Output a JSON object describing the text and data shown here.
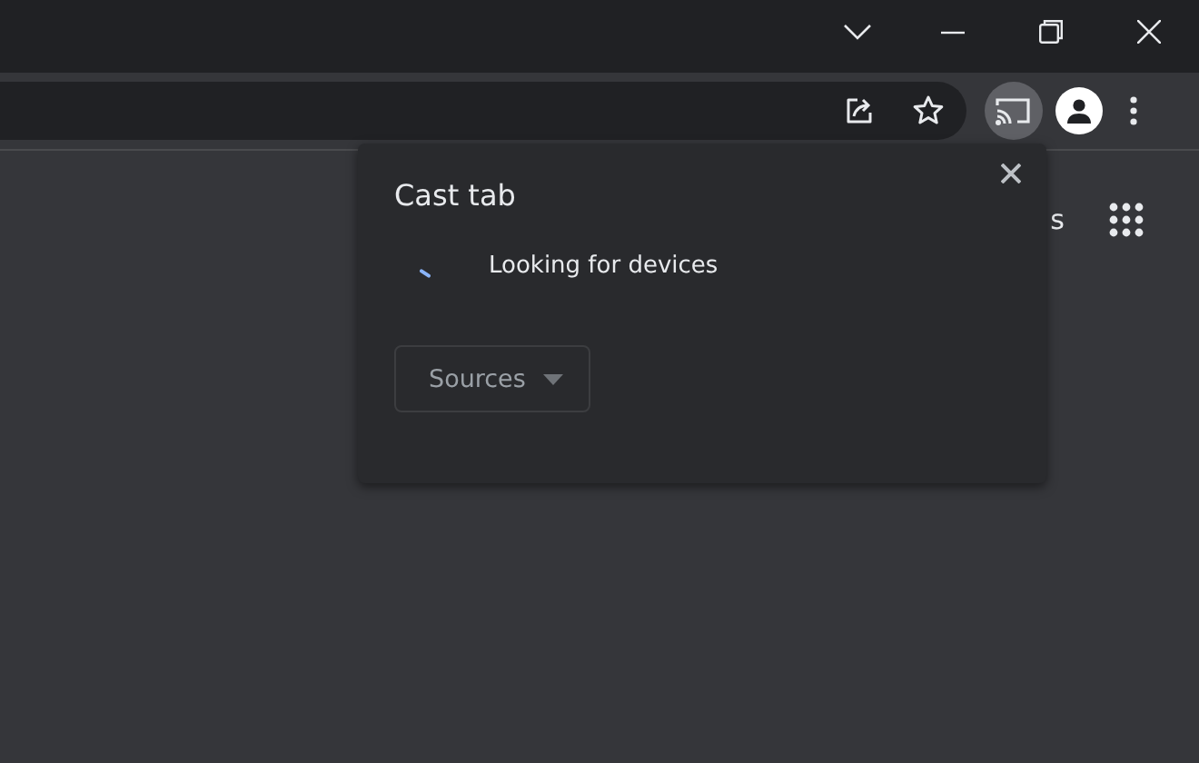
{
  "popup": {
    "title": "Cast tab",
    "status": "Looking for devices",
    "sources_button": "Sources"
  },
  "page": {
    "partial_text": "s"
  }
}
